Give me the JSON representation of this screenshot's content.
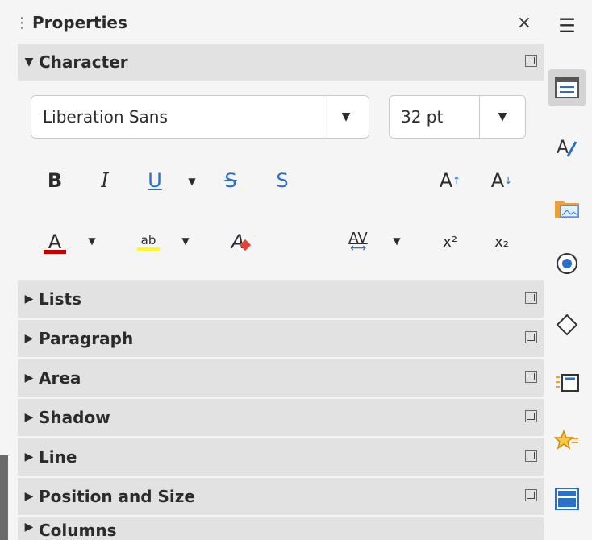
{
  "panel": {
    "title": "Properties",
    "close_glyph": "×",
    "grip_glyph": "⋮"
  },
  "character": {
    "label": "Character",
    "font_name": "Liberation Sans",
    "font_size": "32 pt",
    "tools_row1": [
      "B",
      "I",
      "U",
      "S",
      "S"
    ],
    "grow_label": "A",
    "shrink_label": "A",
    "tools_row2": {
      "font_color": "A",
      "highlight": "ab",
      "clear_format": "A",
      "spacing": "AV",
      "superscript": "x²",
      "subscript": "x₂"
    }
  },
  "sections": [
    {
      "label": "Lists"
    },
    {
      "label": "Paragraph"
    },
    {
      "label": "Area"
    },
    {
      "label": "Shadow"
    },
    {
      "label": "Line"
    },
    {
      "label": "Position and Size"
    },
    {
      "label": "Columns"
    }
  ],
  "colors": {
    "font_color_bar": "#c00000",
    "highlight_bar": "#ffff00",
    "accent": "#2a6fc9"
  },
  "sidebar": {
    "menu_glyph": "☰",
    "tabs": [
      "properties-icon",
      "styles-icon",
      "gallery-icon",
      "navigator-icon",
      "shapes-icon",
      "slide-transition-icon",
      "animation-icon",
      "master-slides-icon"
    ]
  }
}
